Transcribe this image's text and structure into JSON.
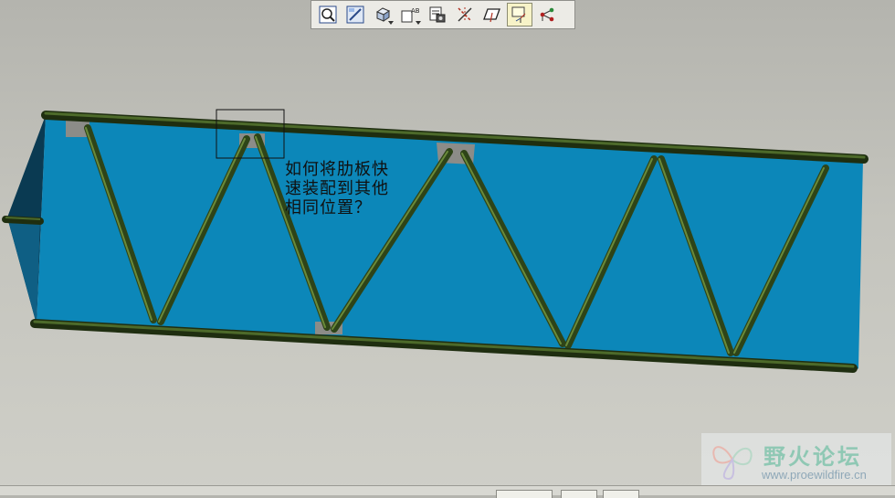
{
  "toolbar": {
    "buttons": [
      {
        "name": "zoom-fit-icon",
        "active": false,
        "dropdown": false
      },
      {
        "name": "repaint-icon",
        "active": false,
        "dropdown": false
      },
      {
        "name": "shading-cube-icon",
        "active": false,
        "dropdown": true
      },
      {
        "name": "saved-view-icon",
        "active": false,
        "dropdown": true
      },
      {
        "name": "layers-icon",
        "active": false,
        "dropdown": false
      },
      {
        "name": "axis-display-icon",
        "active": false,
        "dropdown": false
      },
      {
        "name": "plane-display-icon",
        "active": false,
        "dropdown": false
      },
      {
        "name": "csys-display-icon",
        "active": true,
        "dropdown": false
      },
      {
        "name": "point-display-icon",
        "active": false,
        "dropdown": false
      }
    ],
    "plane_tag": "AB"
  },
  "colors": {
    "panel": "#0c87b9",
    "panel_shadow": "#0f5f84",
    "rod": "#2e4418",
    "rod_highlight": "#6a8a3a",
    "plate": "#8c8c88"
  },
  "model": {
    "question": "如何将肋板快\n速装配到其他\n相同位置？"
  },
  "watermark": {
    "name": "野火论坛",
    "url": "www.proewildfire.cn"
  }
}
